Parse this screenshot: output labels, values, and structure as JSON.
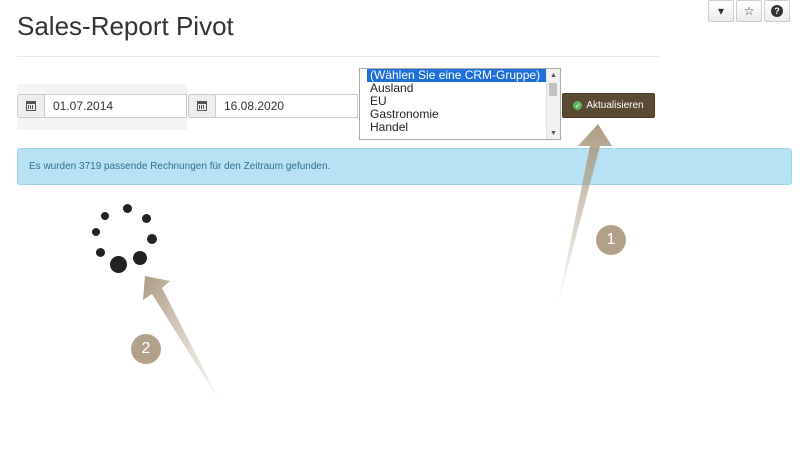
{
  "header": {
    "title": "Sales-Report Pivot"
  },
  "top_buttons": [
    {
      "icon": "caret-down-icon",
      "glyph": "▾"
    },
    {
      "icon": "star-icon",
      "glyph": "☆"
    },
    {
      "icon": "help-icon",
      "glyph": "?"
    }
  ],
  "filters": {
    "start_date": "01.07.2014",
    "end_date": "16.08.2020",
    "crm_groups": [
      {
        "label": "(Wählen Sie eine CRM-Gruppe)",
        "selected": true
      },
      {
        "label": "Ausland",
        "selected": false
      },
      {
        "label": "EU",
        "selected": false
      },
      {
        "label": "Gastronomie",
        "selected": false
      },
      {
        "label": "Handel",
        "selected": false
      }
    ],
    "update_label": "Aktualisieren"
  },
  "alert": {
    "message": "Es wurden 3719 passende Rechnungen für den Zeitraum gefunden."
  },
  "annotations": {
    "badge1": "1",
    "badge2": "2"
  },
  "colors": {
    "accent_button": "#5b4a33",
    "alert_bg": "#b8e2f3",
    "annotation": "#b1a18a",
    "selected_option": "#1e6fd9"
  }
}
